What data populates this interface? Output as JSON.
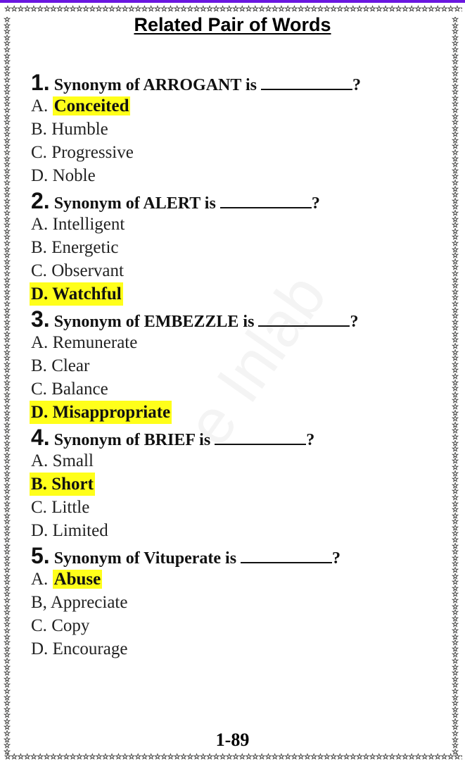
{
  "header": {
    "title": "Related Pair of Words"
  },
  "decoration": {
    "border_icon": "star-icon",
    "accent_color": "#6a16e0",
    "highlight_color": "#ffff1a",
    "star_color": "#e8e23a"
  },
  "watermark": "e Inlab",
  "questions": [
    {
      "number": "1.",
      "text": "Synonym of ARROGANT is",
      "suffix": "?",
      "options": [
        {
          "letter": "A.",
          "text": "Conceited",
          "answer": true
        },
        {
          "letter": "B.",
          "text": "Humble",
          "answer": false
        },
        {
          "letter": "C.",
          "text": "Progressive",
          "answer": false
        },
        {
          "letter": "D.",
          "text": "Noble",
          "answer": false
        }
      ]
    },
    {
      "number": "2.",
      "text": "Synonym of ALERT is",
      "suffix": "?",
      "options": [
        {
          "letter": "A.",
          "text": "Intelligent",
          "answer": false
        },
        {
          "letter": "B.",
          "text": "Energetic",
          "answer": false
        },
        {
          "letter": "C.",
          "text": "Observant",
          "answer": false
        },
        {
          "letter": "D.",
          "text": "Watchful",
          "answer": true
        }
      ]
    },
    {
      "number": "3.",
      "text": "Synonym of EMBEZZLE is",
      "suffix": "?",
      "options": [
        {
          "letter": "A.",
          "text": "Remunerate",
          "answer": false
        },
        {
          "letter": "B.",
          "text": "Clear",
          "answer": false
        },
        {
          "letter": "C.",
          "text": "Balance",
          "answer": false
        },
        {
          "letter": "D.",
          "text": "Misappropriate",
          "answer": true
        }
      ]
    },
    {
      "number": "4.",
      "text": "Synonym of BRIEF is",
      "suffix": "?",
      "options": [
        {
          "letter": "A.",
          "text": "Small",
          "answer": false
        },
        {
          "letter": "B.",
          "text": "Short",
          "answer": true
        },
        {
          "letter": "C.",
          "text": "Little",
          "answer": false
        },
        {
          "letter": "D.",
          "text": "Limited",
          "answer": false
        }
      ]
    },
    {
      "number": "5.",
      "text": "Synonym of Vituperate is",
      "suffix": "?",
      "options": [
        {
          "letter": "A.",
          "text": "Abuse",
          "answer": true
        },
        {
          "letter": "B,",
          "text": "Appreciate",
          "answer": false
        },
        {
          "letter": "C.",
          "text": "Copy",
          "answer": false
        },
        {
          "letter": "D.",
          "text": "Encourage",
          "answer": false
        }
      ]
    }
  ],
  "footer": {
    "page_number": "1-89"
  }
}
